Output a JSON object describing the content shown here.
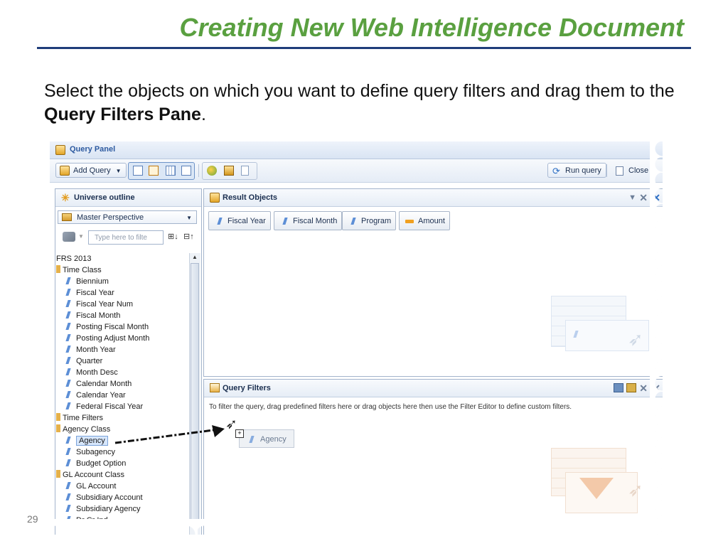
{
  "slide": {
    "title": "Creating New Web Intelligence Document",
    "intro_text": "Select the objects on which you want to define query filters and drag them to the ",
    "intro_bold": "Query Filters Pane",
    "intro_end": ".",
    "page_number": "29"
  },
  "colors": {
    "title": "#5aa040",
    "rule": "#1f3d7a",
    "selection": "#d6e6fb"
  },
  "query_panel": {
    "title": "Query Panel",
    "toolbar": {
      "add_query": "Add Query",
      "run_query": "Run query",
      "close": "Close"
    },
    "universe_outline": {
      "header": "Universe outline",
      "perspective": "Master Perspective",
      "search_placeholder": "Type here to filte",
      "items": [
        {
          "label": "FRS 2013",
          "type": "universe"
        },
        {
          "label": "Time Class",
          "type": "folder"
        },
        {
          "label": "Biennium",
          "type": "object"
        },
        {
          "label": "Fiscal Year",
          "type": "object"
        },
        {
          "label": "Fiscal Year Num",
          "type": "object"
        },
        {
          "label": "Fiscal Month",
          "type": "object"
        },
        {
          "label": "Posting Fiscal Month",
          "type": "object"
        },
        {
          "label": "Posting Adjust Month",
          "type": "object"
        },
        {
          "label": "Month Year",
          "type": "object"
        },
        {
          "label": "Quarter",
          "type": "object"
        },
        {
          "label": "Month Desc",
          "type": "object"
        },
        {
          "label": "Calendar Month",
          "type": "object"
        },
        {
          "label": "Calendar Year",
          "type": "object"
        },
        {
          "label": "Federal Fiscal Year",
          "type": "object"
        },
        {
          "label": "Time Filters",
          "type": "folder"
        },
        {
          "label": "Agency Class",
          "type": "folder"
        },
        {
          "label": "Agency",
          "type": "object",
          "selected": true
        },
        {
          "label": "Subagency",
          "type": "object"
        },
        {
          "label": "Budget Option",
          "type": "object"
        },
        {
          "label": "GL Account Class",
          "type": "folder"
        },
        {
          "label": "GL Account",
          "type": "object"
        },
        {
          "label": "Subsidiary Account",
          "type": "object"
        },
        {
          "label": "Subsidiary Agency",
          "type": "object"
        },
        {
          "label": "Dr Cr Ind",
          "type": "object"
        }
      ]
    },
    "result_objects": {
      "header": "Result Objects",
      "objects": [
        {
          "label": "Fiscal Year",
          "type": "dimension"
        },
        {
          "label": "Fiscal Month",
          "type": "dimension"
        },
        {
          "label": "Program",
          "type": "dimension"
        },
        {
          "label": "Amount",
          "type": "measure"
        }
      ]
    },
    "query_filters": {
      "header": "Query Filters",
      "hint": "To filter the query, drag predefined filters here or drag objects here then use the Filter Editor to define custom filters.",
      "dragged_object": "Agency"
    }
  }
}
